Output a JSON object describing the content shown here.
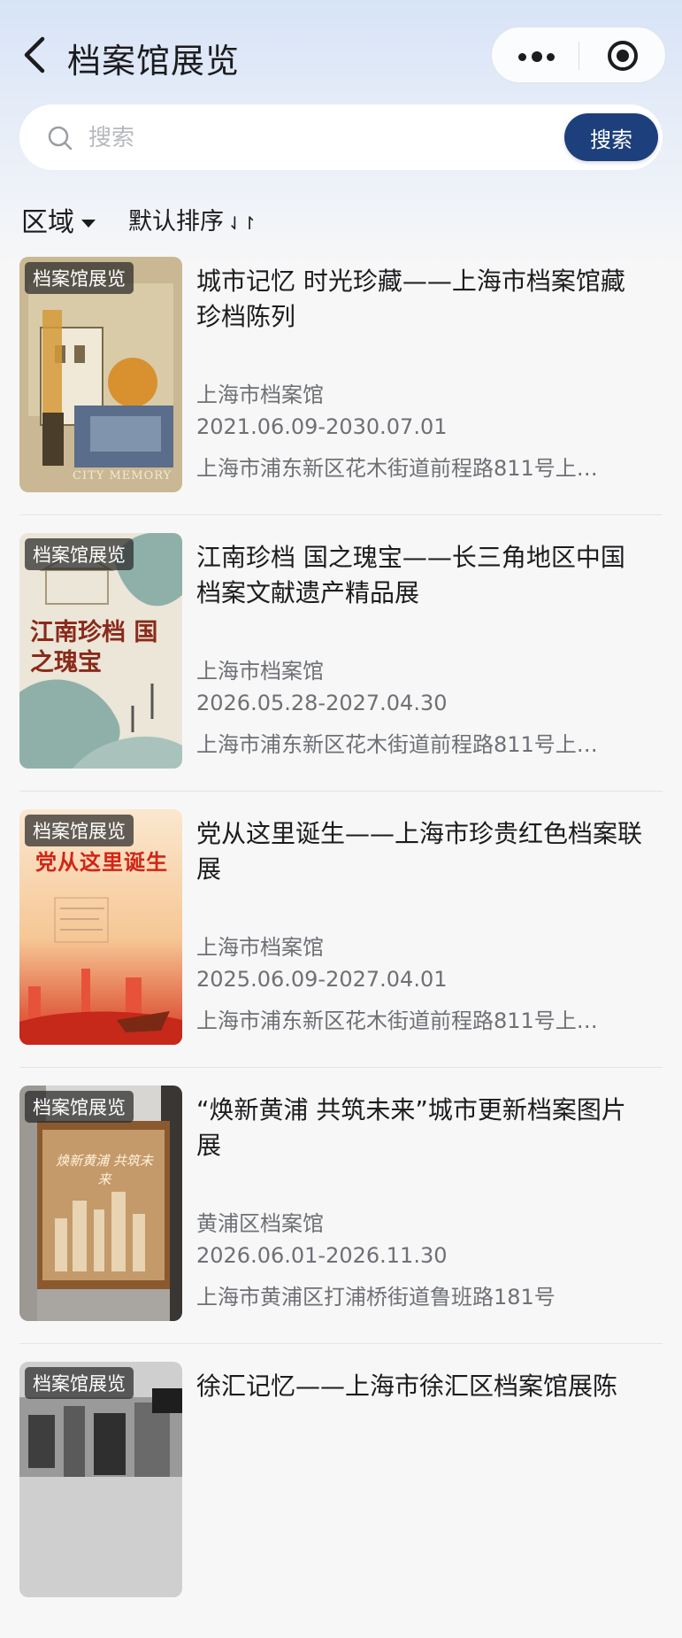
{
  "header": {
    "title": "档案馆展览"
  },
  "search": {
    "placeholder": "搜索",
    "button_label": "搜索"
  },
  "filters": {
    "region_label": "区域",
    "sort_label": "默认排序",
    "sort_icon": "⇃↾"
  },
  "colors": {
    "accent": "#1d3f7c",
    "muted_text": "#6e7075"
  },
  "exhibitions": [
    {
      "tag": "档案馆展览",
      "title": "城市记忆 时光珍藏——上海市档案馆藏珍档陈列",
      "org": "上海市档案馆",
      "date": "2021.06.09-2030.07.01",
      "address": "上海市浦东新区花木街道前程路811号上…",
      "poster_caption": "CITY MEMORY"
    },
    {
      "tag": "档案馆展览",
      "title": "江南珍档 国之瑰宝——长三角地区中国档案文献遗产精品展",
      "org": "上海市档案馆",
      "date": "2026.05.28-2027.04.30",
      "address": "上海市浦东新区花木街道前程路811号上…",
      "poster_caption": "江南珍档 国之瑰宝"
    },
    {
      "tag": "档案馆展览",
      "title": "党从这里诞生——上海市珍贵红色档案联展",
      "org": "上海市档案馆",
      "date": "2025.06.09-2027.04.01",
      "address": "上海市浦东新区花木街道前程路811号上…",
      "poster_caption": "党从这里诞生"
    },
    {
      "tag": "档案馆展览",
      "title": "“焕新黄浦 共筑未来”城市更新档案图片展",
      "org": "黄浦区档案馆",
      "date": "2026.06.01-2026.11.30",
      "address": "上海市黄浦区打浦桥街道鲁班路181号",
      "poster_caption": "焕新黄浦 共筑未来"
    },
    {
      "tag": "档案馆展览",
      "title": "徐汇记忆——上海市徐汇区档案馆展陈",
      "org": "",
      "date": "",
      "address": "",
      "poster_caption": ""
    }
  ]
}
